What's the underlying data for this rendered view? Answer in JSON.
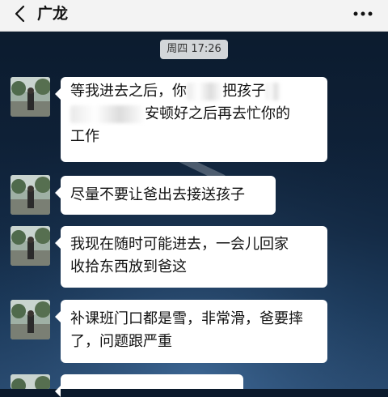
{
  "header": {
    "title": "广龙",
    "back_icon": "chevron-left-icon",
    "more_icon": "more-dots-icon"
  },
  "timestamp": "周四 17:26",
  "messages": [
    {
      "lines": [
        "等我进去之后，你",
        "把孩子",
        "安顿好之后再去忙你的",
        "工作"
      ]
    },
    {
      "lines": [
        "尽量不要让爸出去接送孩子"
      ]
    },
    {
      "lines": [
        "我现在随时可能进去，一会儿回家",
        "收拾东西放到爸这"
      ]
    },
    {
      "lines": [
        "补课班门口都是雪，非常滑，爸要摔",
        "了，问题跟严重"
      ]
    }
  ],
  "colors": {
    "header_bg": "#f3f3f3",
    "bubble_bg": "#ffffff",
    "chat_bg": "#0e2036"
  }
}
